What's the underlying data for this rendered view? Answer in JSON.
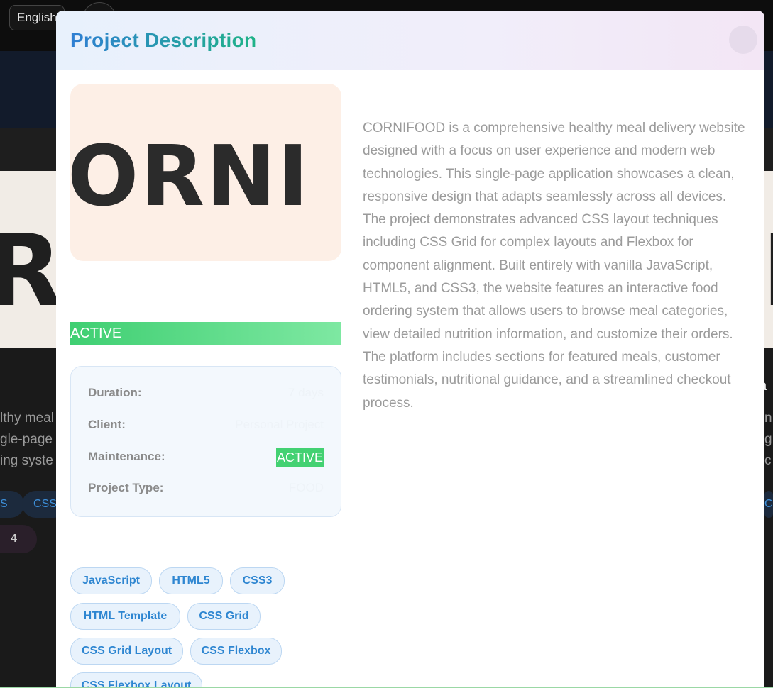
{
  "background": {
    "language_label": "English",
    "image_text": "RI",
    "right_image_text": "R",
    "left_text_lines": [
      "lthy meal",
      "gle-page",
      "ing syste"
    ],
    "right_text_lines": [
      "n",
      "g",
      "c"
    ],
    "right_letter": "a",
    "left_chips": [
      "S",
      "CSS"
    ],
    "right_chip": "C",
    "counter": "4"
  },
  "modal": {
    "title": "Project Description",
    "image_logo_text": "ORNI",
    "status_badge": "ACTIVE",
    "details": {
      "duration_label": "Duration:",
      "duration_value": "7 days",
      "client_label": "Client:",
      "client_value": "Personal Project",
      "maintenance_label": "Maintenance:",
      "maintenance_value": "ACTIVE",
      "type_label": "Project Type:",
      "type_value": "FOOD"
    },
    "description": "CORNIFOOD is a comprehensive healthy meal delivery website designed with a focus on user experience and modern web technologies. This single-page application showcases a clean, responsive design that adapts seamlessly across all devices. The project demonstrates advanced CSS layout techniques including CSS Grid for complex layouts and Flexbox for component alignment. Built entirely with vanilla JavaScript, HTML5, and CSS3, the website features an interactive food ordering system that allows users to browse meal categories, view detailed nutrition information, and customize their orders. The platform includes sections for featured meals, customer testimonials, nutritional guidance, and a streamlined checkout process.",
    "tags": [
      "JavaScript",
      "HTML5",
      "CSS3",
      "HTML Template",
      "CSS Grid",
      "CSS Grid Layout",
      "CSS Flexbox",
      "CSS Flexbox Layout"
    ]
  },
  "colors": {
    "title_gradient_start": "#2f7fd3",
    "title_gradient_end": "#1fb387",
    "active_green": "#43d172",
    "tag_text": "#2e86d1",
    "tag_bg": "#e8f2fc"
  }
}
